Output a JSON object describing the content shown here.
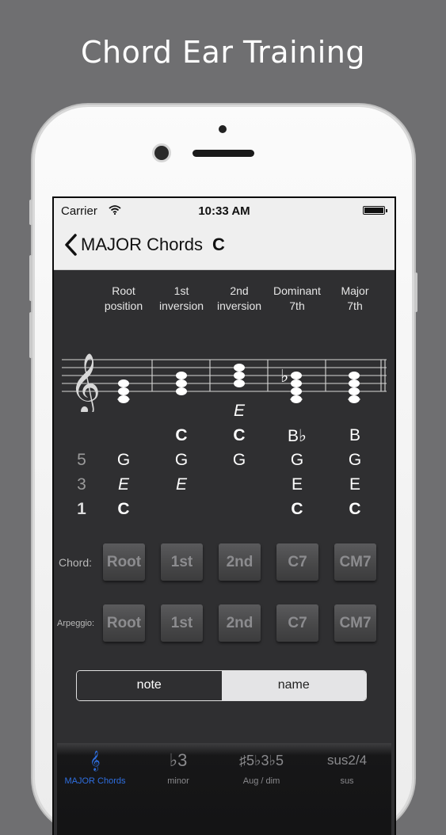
{
  "promo": {
    "title": "Chord Ear Training"
  },
  "status": {
    "carrier": "Carrier",
    "time": "10:33 AM"
  },
  "nav": {
    "back_label": "MAJOR Chords",
    "key": "C"
  },
  "columns": [
    {
      "line1": "Root",
      "line2": "position"
    },
    {
      "line1": "1st",
      "line2": "inversion"
    },
    {
      "line1": "2nd",
      "line2": "inversion"
    },
    {
      "line1": "Dominant",
      "line2": "7th"
    },
    {
      "line1": "Major",
      "line2": "7th"
    }
  ],
  "staff": {
    "clef": "𝄞",
    "flat": "♭"
  },
  "intervals": {
    "fifth": "5",
    "third": "3",
    "root": "1"
  },
  "notes": {
    "col1": {
      "fifth": "G",
      "third": "E",
      "root": "C"
    },
    "col2": {
      "top": "C",
      "fifth": "G",
      "third": "E"
    },
    "col3": {
      "top2": "E",
      "top": "C",
      "fifth": "G"
    },
    "col4": {
      "seventh": "B♭",
      "fifth": "G",
      "third": "E",
      "root": "C"
    },
    "col5": {
      "seventh": "B",
      "fifth": "G",
      "third": "E",
      "root": "C"
    }
  },
  "chord_row": {
    "label": "Chord:",
    "buttons": [
      "Root",
      "1st",
      "2nd",
      "C7",
      "CM7"
    ]
  },
  "arpeggio_row": {
    "label": "Arpeggio:",
    "buttons": [
      "Root",
      "1st",
      "2nd",
      "C7",
      "CM7"
    ]
  },
  "segment": {
    "note": "note",
    "name": "name",
    "selected": "name"
  },
  "tabs": [
    {
      "icon": "𝄞",
      "icon_name": "treble-clef-icon",
      "label": "MAJOR Chords",
      "active": true
    },
    {
      "icon": "♭3",
      "icon_name": "flat-three-icon",
      "label": "minor",
      "active": false
    },
    {
      "icon": "♯5♭3♭5",
      "icon_name": "aug-dim-icon",
      "label": "Aug / dim",
      "active": false
    },
    {
      "icon": "sus2/4",
      "icon_name": "sus-icon",
      "label": "sus",
      "active": false
    }
  ],
  "colors": {
    "background": "#6f6f71",
    "screen": "#2f2f31",
    "accent": "#2f6fe0"
  }
}
